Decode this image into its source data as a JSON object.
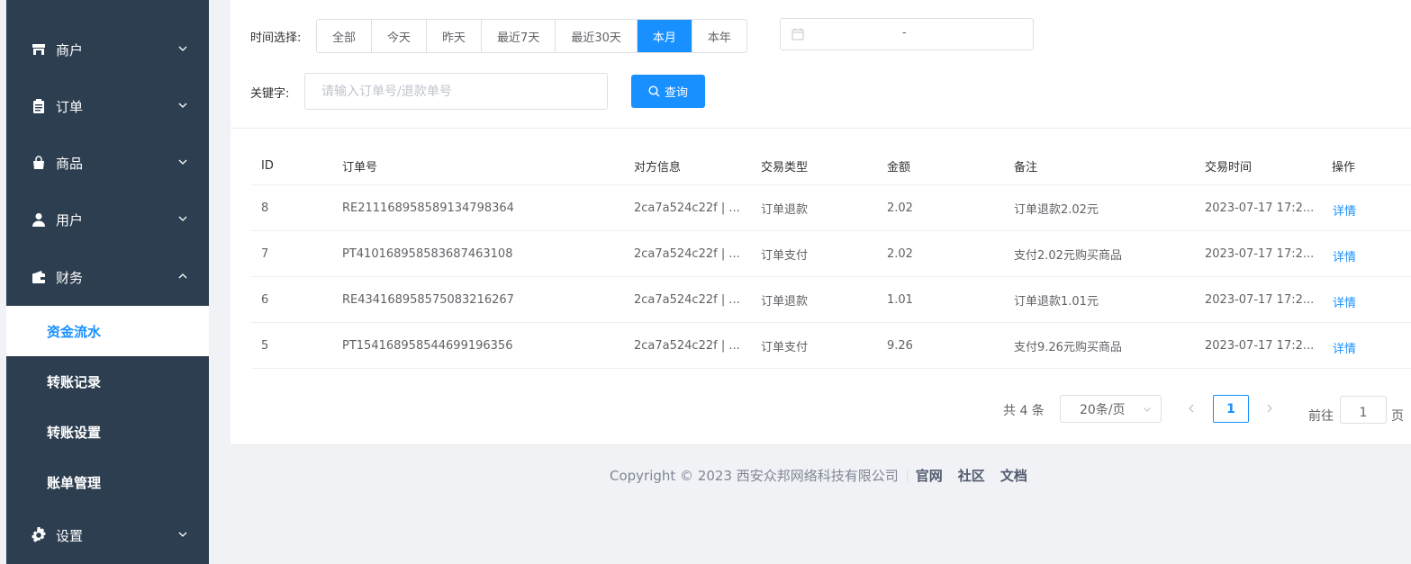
{
  "sidebar": {
    "menus": [
      {
        "label": "商户",
        "icon": "store-icon"
      },
      {
        "label": "订单",
        "icon": "clipboard-icon"
      },
      {
        "label": "商品",
        "icon": "shopping-bag-icon"
      },
      {
        "label": "用户",
        "icon": "user-icon"
      },
      {
        "label": "财务",
        "icon": "wallet-icon"
      },
      {
        "label": "设置",
        "icon": "gear-icon"
      }
    ],
    "finance_sub": [
      "资金流水",
      "转账记录",
      "转账设置",
      "账单管理"
    ],
    "active_sub": "资金流水"
  },
  "filters": {
    "time_label": "时间选择:",
    "time_options": [
      "全部",
      "今天",
      "昨天",
      "最近7天",
      "最近30天",
      "本月",
      "本年"
    ],
    "time_selected": "本月",
    "date_separator": "-",
    "keyword_label": "关键字:",
    "keyword_placeholder": "请输入订单号/退款单号",
    "search_button": "查询"
  },
  "table": {
    "headers": [
      "ID",
      "订单号",
      "对方信息",
      "交易类型",
      "金额",
      "备注",
      "交易时间",
      "操作"
    ],
    "rows": [
      {
        "id": "8",
        "order_no": "RE211168958589134798364",
        "counterparty": "2ca7a524c22f | ...",
        "type": "订单退款",
        "amount": "2.02",
        "note": "订单退款2.02元",
        "time": "2023-07-17 17:2...",
        "action": "详情"
      },
      {
        "id": "7",
        "order_no": "PT410168958583687463108",
        "counterparty": "2ca7a524c22f | ...",
        "type": "订单支付",
        "amount": "2.02",
        "note": "支付2.02元购买商品",
        "time": "2023-07-17 17:2...",
        "action": "详情"
      },
      {
        "id": "6",
        "order_no": "RE434168958575083216267",
        "counterparty": "2ca7a524c22f | ...",
        "type": "订单退款",
        "amount": "1.01",
        "note": "订单退款1.01元",
        "time": "2023-07-17 17:2...",
        "action": "详情"
      },
      {
        "id": "5",
        "order_no": "PT154168958544699196356",
        "counterparty": "2ca7a524c22f | ...",
        "type": "订单支付",
        "amount": "9.26",
        "note": "支付9.26元购买商品",
        "time": "2023-07-17 17:2...",
        "action": "详情"
      }
    ]
  },
  "pagination": {
    "total": "共 4 条",
    "page_size": "20条/页",
    "current_page": "1",
    "goto_label": "前往",
    "goto_value": "1",
    "page_unit": "页"
  },
  "footer": {
    "copyright": "Copyright © 2023 西安众邦网络科技有限公司",
    "links": [
      "官网",
      "社区",
      "文档"
    ]
  },
  "colors": {
    "sidebar_bg": "#2c3e50",
    "accent": "#1890ff"
  }
}
